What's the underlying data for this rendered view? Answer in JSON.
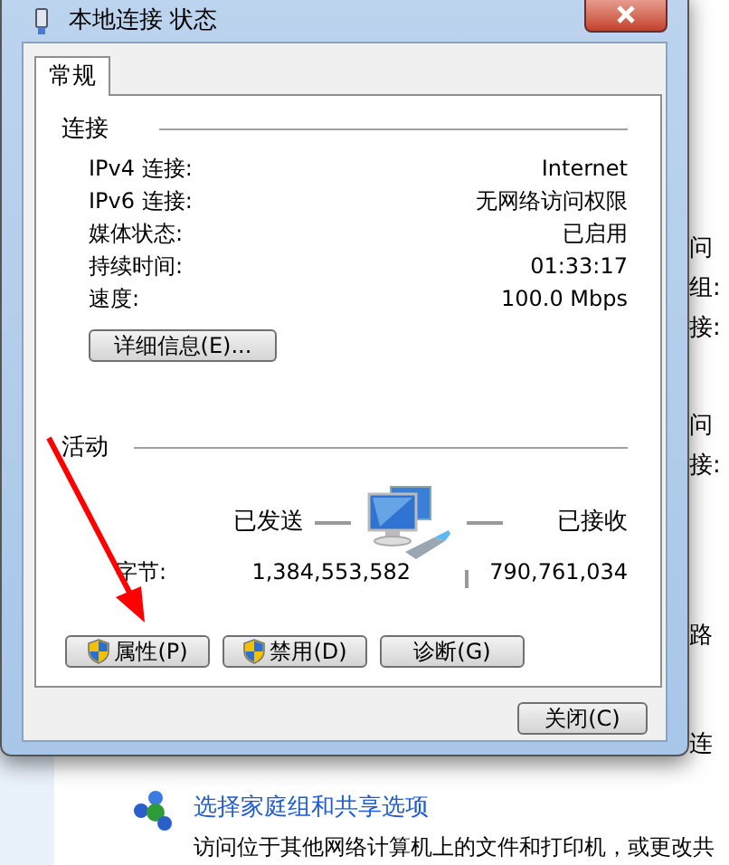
{
  "window": {
    "title": "本地连接 状态"
  },
  "tabs": [
    {
      "label": "常规",
      "selected": true
    }
  ],
  "connection": {
    "heading": "连接",
    "rows": [
      {
        "label": "IPv4 连接:",
        "value": "Internet"
      },
      {
        "label": "IPv6 连接:",
        "value": "无网络访问权限"
      },
      {
        "label": "媒体状态:",
        "value": "已启用"
      },
      {
        "label": "持续时间:",
        "value": "01:33:17"
      },
      {
        "label": "速度:",
        "value": "100.0 Mbps"
      }
    ]
  },
  "details_button": "详细信息(E)...",
  "activity": {
    "heading": "活动",
    "sent_label": "已发送",
    "received_label": "已接收",
    "bytes_label": "字节:",
    "bytes_sent": "1,384,553,582",
    "bytes_received": "790,761,034"
  },
  "buttons": [
    {
      "label": "属性(P)",
      "shield": true
    },
    {
      "label": "禁用(D)",
      "shield": true
    },
    {
      "label": "诊断(G)",
      "shield": false
    }
  ],
  "close_button": "关闭(C)",
  "background": {
    "fragments": [
      "问",
      "组:",
      "接:",
      "问",
      "接:",
      "路",
      "连"
    ],
    "link": "选择家庭组和共享选项",
    "description": "访问位于其他网络计算机上的文件和打印机，或更改共"
  }
}
